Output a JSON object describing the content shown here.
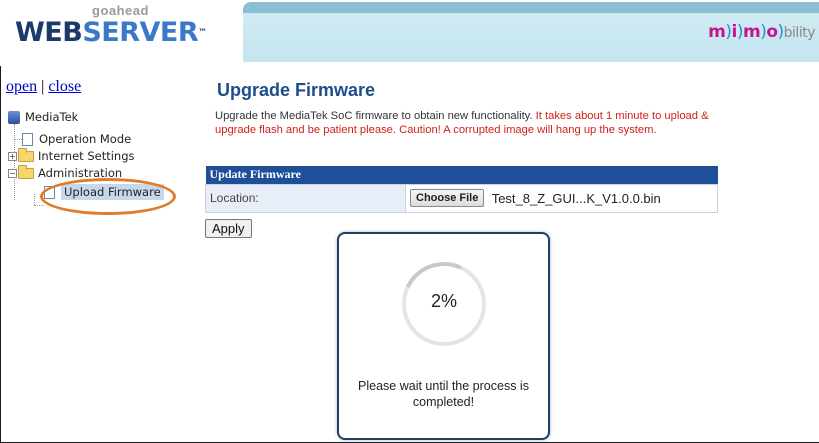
{
  "header": {
    "brand_small": "goahead",
    "brand_web": "WEB",
    "brand_server": "SERVER",
    "brand_tm": "™",
    "partner_logo": {
      "m1": "m",
      "p1": ")",
      "i": "i",
      "p2": ")",
      "m2": "m",
      "p3": ")",
      "o": "o",
      "p4": ")",
      "tail": "bility"
    }
  },
  "sidebar": {
    "open_label": "open",
    "separator": "|",
    "close_label": "close",
    "tree": {
      "root": "MediaTek",
      "items": [
        {
          "label": "Operation Mode"
        },
        {
          "label": "Internet Settings"
        },
        {
          "label": "Administration"
        },
        {
          "label": "Upload Firmware"
        }
      ]
    }
  },
  "main": {
    "title": "Upgrade Firmware",
    "description_normal": "Upgrade the MediaTek SoC firmware to obtain new functionality. ",
    "description_warning": "It takes about 1 minute to upload & upgrade flash and be patient please. Caution! A corrupted image will hang up the system.",
    "table_header": "Update Firmware",
    "location_label": "Location:",
    "choose_file_label": "Choose File",
    "file_name": "Test_8_Z_GUI...K_V1.0.0.bin",
    "apply_label": "Apply"
  },
  "modal": {
    "progress_text": "2%",
    "progress_value": 2,
    "message": "Please wait until the process is completed!"
  },
  "colors": {
    "title_blue": "#1e4d8c",
    "table_header_bg": "#1f4f99",
    "warning_red": "#d0211a",
    "highlight_oval": "#e07b2a"
  }
}
